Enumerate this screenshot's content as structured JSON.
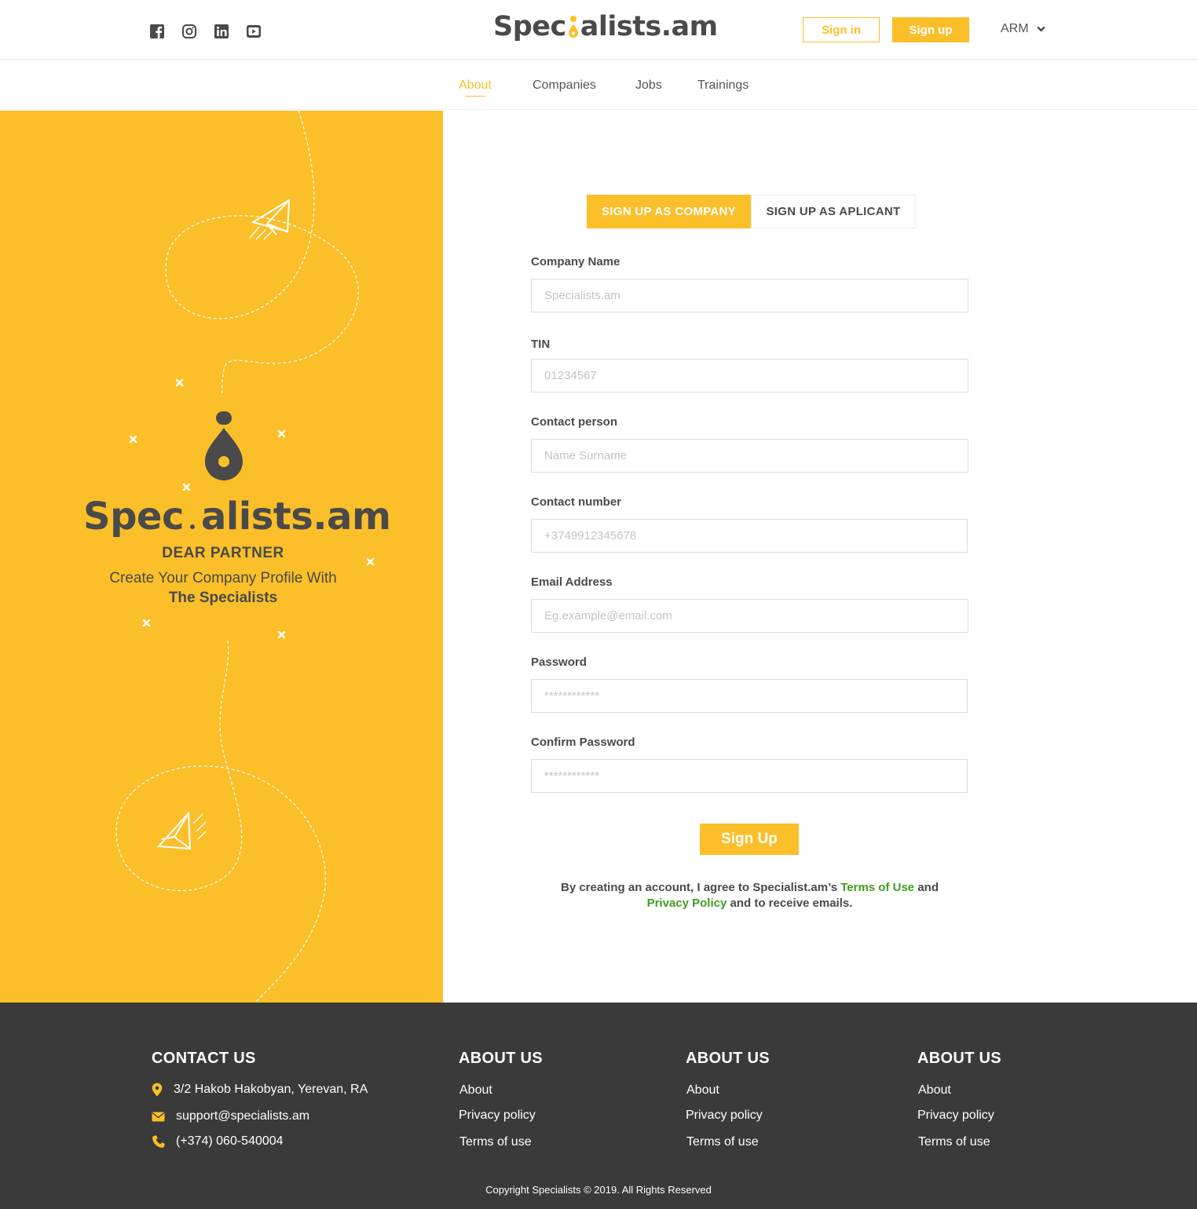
{
  "header": {
    "social": [
      "facebook-icon",
      "instagram-icon",
      "linkedin-icon",
      "youtube-icon"
    ],
    "logo_pre": "Spec",
    "logo_post": "alists.am",
    "signin_label": "Sign in",
    "signup_label": "Sign up",
    "language": "ARM"
  },
  "nav": {
    "items": [
      {
        "label": "About",
        "active": true
      },
      {
        "label": "Companies"
      },
      {
        "label": "Jobs"
      },
      {
        "label": "Trainings"
      }
    ]
  },
  "hero": {
    "logo_pre": "Spec",
    "logo_post": "alists.am",
    "greeting": "DEAR PARTNER",
    "subtitle": "Create Your Company Profile With",
    "subtitle_bold": "The Specialists"
  },
  "form": {
    "tabs": [
      {
        "label": "SIGN UP AS COMPANY",
        "active": true
      },
      {
        "label": "SIGN UP AS APLICANT"
      }
    ],
    "fields": [
      {
        "label": "Company Name",
        "placeholder": "Specialists.am"
      },
      {
        "label": "TIN",
        "placeholder": "01234567"
      },
      {
        "label": "Contact person",
        "placeholder": "Name Surname"
      },
      {
        "label": "Contact number",
        "placeholder": "+3749912345678"
      },
      {
        "label": "Email Address",
        "placeholder": "Eg.example@email.com"
      },
      {
        "label": "Password",
        "placeholder": "************"
      },
      {
        "label": "Confirm Password",
        "placeholder": "************"
      }
    ],
    "submit_label": "Sign Up",
    "agree_pre": "By creating an account, I agree to Specialist.am’s ",
    "terms_label": "Terms of Use",
    "agree_mid": " and ",
    "privacy_label": "Privacy Policy",
    "agree_post": " and to receive emails."
  },
  "footer": {
    "contact_title": "CONTACT US",
    "address": "3/2 Hakob Hakobyan, Yerevan, RA",
    "email": "support@specialists.am",
    "phone": "(+374) 060-540004",
    "columns": [
      {
        "title": "ABOUT US",
        "links": [
          "About",
          "Privacy policy",
          "Terms of use"
        ]
      },
      {
        "title": "ABOUT US",
        "links": [
          "About",
          "Privacy policy",
          "Terms of use"
        ]
      },
      {
        "title": "ABOUT US",
        "links": [
          "About",
          "Privacy policy",
          "Terms of use"
        ]
      }
    ],
    "copyright": "Copyright Specialists © 2019. All Rights Reserved"
  },
  "colors": {
    "accent": "#fbbf2a",
    "dark": "#4a4a4a",
    "link_green": "#3f9f1f",
    "footer_bg": "#3a3a3a"
  }
}
